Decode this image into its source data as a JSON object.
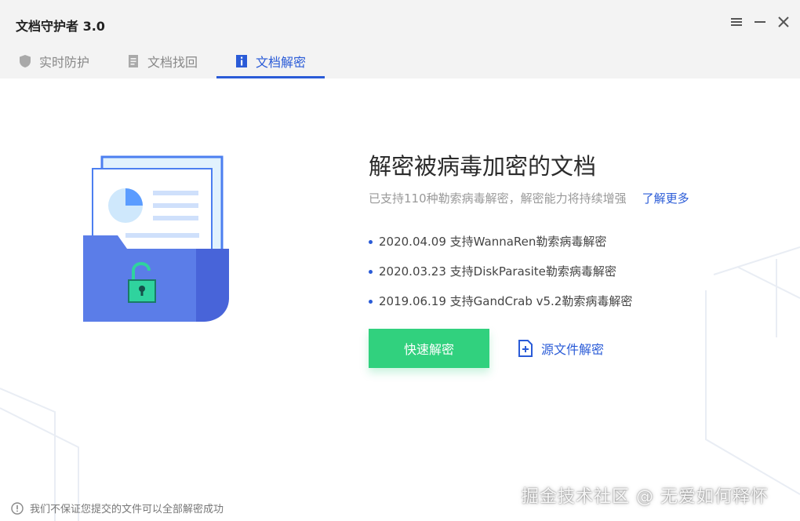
{
  "app": {
    "title": "文档守护者 3.0"
  },
  "window_controls": {
    "menu_icon": "menu-icon",
    "minimize_icon": "minimize-icon",
    "close_icon": "close-icon"
  },
  "tabs": [
    {
      "label": "实时防护",
      "icon": "shield-icon",
      "active": false
    },
    {
      "label": "文档找回",
      "icon": "document-icon",
      "active": false
    },
    {
      "label": "文档解密",
      "icon": "info-doc-icon",
      "active": true
    }
  ],
  "main": {
    "headline": "解密被病毒加密的文档",
    "subline": "已支持110种勒索病毒解密，解密能力将持续增强",
    "learn_more": "了解更多",
    "updates": [
      "2020.04.09 支持WannaRen勒索病毒解密",
      "2020.03.23 支持DiskParasite勒索病毒解密",
      "2019.06.19 支持GandCrab v5.2勒索病毒解密"
    ],
    "primary_button": "快速解密",
    "secondary_button": "源文件解密"
  },
  "footer": {
    "note": "我们不保证您提交的文件可以全部解密成功"
  },
  "watermark": "掘金技术社区 @ 无爱如何释怀",
  "colors": {
    "accent": "#2a5bd7",
    "primary_button": "#31d17e",
    "folder": "#5b7de8",
    "lock": "#2fd39e"
  }
}
